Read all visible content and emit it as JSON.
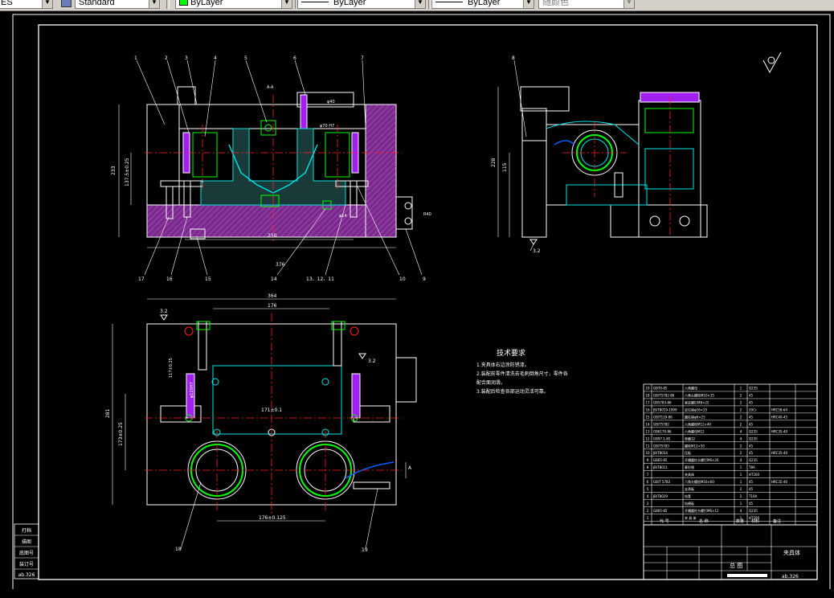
{
  "toolbar": {
    "layer_partial": "ES",
    "text_style": "Standard",
    "layer": "ByLayer",
    "linetype": "ByLayer",
    "lineweight": "ByLayer",
    "plot_style": "随颜色",
    "colors": {
      "layer_swatch": "#00ff00",
      "toolbar_bg": "#d4d0c8"
    }
  },
  "drawing": {
    "background": "#000000",
    "tech_req": {
      "title": "技术要求",
      "lines": [
        "1.夹具体右边涂防锈漆。",
        "2.装配前零件清洗去毛刺倒角尺寸，零件各",
        "配合面润滑。",
        "3.装配后检查各部运动灵活可靠。"
      ]
    },
    "front_view_labels": [
      "1",
      "2",
      "3",
      "4",
      "5",
      "6",
      "7"
    ],
    "front_bottom_labels": [
      "17",
      "16",
      "15",
      "14",
      "13、12、11",
      "10",
      "9"
    ],
    "side_label_8": "8",
    "plan_labels": [
      "18",
      "19"
    ],
    "front_dims": {
      "dim_phi40": "φ40",
      "dim_phi70": "φ70 H7",
      "dim_phi45": "φ45H7",
      "dim_height": "233",
      "dim_inner": "137.5±0.25",
      "dim_250": "250",
      "dim_376": "376",
      "dim_a_a": "A-A",
      "dim_phi14": "φ14",
      "dim_r40": "R40",
      "dim_phi48": "φ48"
    },
    "side_dims": {
      "dim_228": "228",
      "dim_115": "115",
      "dim_3_2": "3.2"
    },
    "plan_dims": {
      "dim_364": "364",
      "dim_176": "176",
      "dim_3_2a": "3.2",
      "dim_3_2b": "3.2",
      "dim_281": "281",
      "dim_117": "117±0.25",
      "dim_120": "φ120H7",
      "dim_171": "171±0.1",
      "dim_173": "173±0.25",
      "dim_176b": "176±0.125",
      "dim_a": "A"
    },
    "side_labels": [
      "打档",
      "描图",
      "底图号",
      "装订号",
      "ab.326"
    ],
    "title_block": {
      "name": "夹具体",
      "part": "总 图",
      "code": "ab.326",
      "col_headers": [
        "序号",
        "代 号",
        "名 称",
        "数量",
        "材料",
        "备注"
      ]
    },
    "bom_rows": [
      [
        "19",
        "GB70-85",
        "六角螺母",
        "1",
        "Q235",
        ""
      ],
      [
        "18",
        "GB/T5782-86",
        "六角头螺栓M10×35",
        "2",
        "45",
        ""
      ],
      [
        "17",
        "GB5783-86",
        "紧定螺钉M8×25",
        "2",
        "45",
        ""
      ],
      [
        "16",
        "JB/T8019-1999",
        "定位销φ16×25",
        "2",
        "20Cr",
        "HRC58-64"
      ],
      [
        "15",
        "GB/T119-86",
        "圆柱销φ6×25",
        "2",
        "45",
        "HRC40-45"
      ],
      [
        "14",
        "GB/T5782",
        "六角螺栓M12×40",
        "2",
        "45",
        ""
      ],
      [
        "13",
        "GB6170-86",
        "六角螺母M12",
        "4",
        "Q235",
        "HRC35-40"
      ],
      [
        "12",
        "GB97.1-85",
        "垫圈12",
        "4",
        "Q235",
        ""
      ],
      [
        "11",
        "GB/T5783",
        "螺栓M12×50",
        "2",
        "45",
        ""
      ],
      [
        "10",
        "JB/T8034",
        "压板",
        "2",
        "45",
        "HRC35-40"
      ],
      [
        "9",
        "GB65-85",
        "开槽圆柱头螺钉M6×20",
        "4",
        "Q235",
        ""
      ],
      [
        "8",
        "JB/T8011",
        "菱形销",
        "1",
        "T8A",
        ""
      ],
      [
        "7",
        "",
        "夹具体",
        "1",
        "HT200",
        ""
      ],
      [
        "6",
        "GB/T 5783",
        "六角头螺栓M16×60",
        "1",
        "45",
        "HRC35-40"
      ],
      [
        "5",
        "",
        "支承板",
        "2",
        "45",
        ""
      ],
      [
        "4",
        "JB/T8029",
        "钻套",
        "2",
        "T10A",
        ""
      ],
      [
        "3",
        "",
        "钻模板",
        "1",
        "45",
        ""
      ],
      [
        "2",
        "GB65-85",
        "开槽圆柱头螺钉M6×12",
        "4",
        "Q235",
        ""
      ],
      [
        "1",
        "",
        "夹 具 体",
        "1",
        "HT200",
        ""
      ]
    ]
  }
}
